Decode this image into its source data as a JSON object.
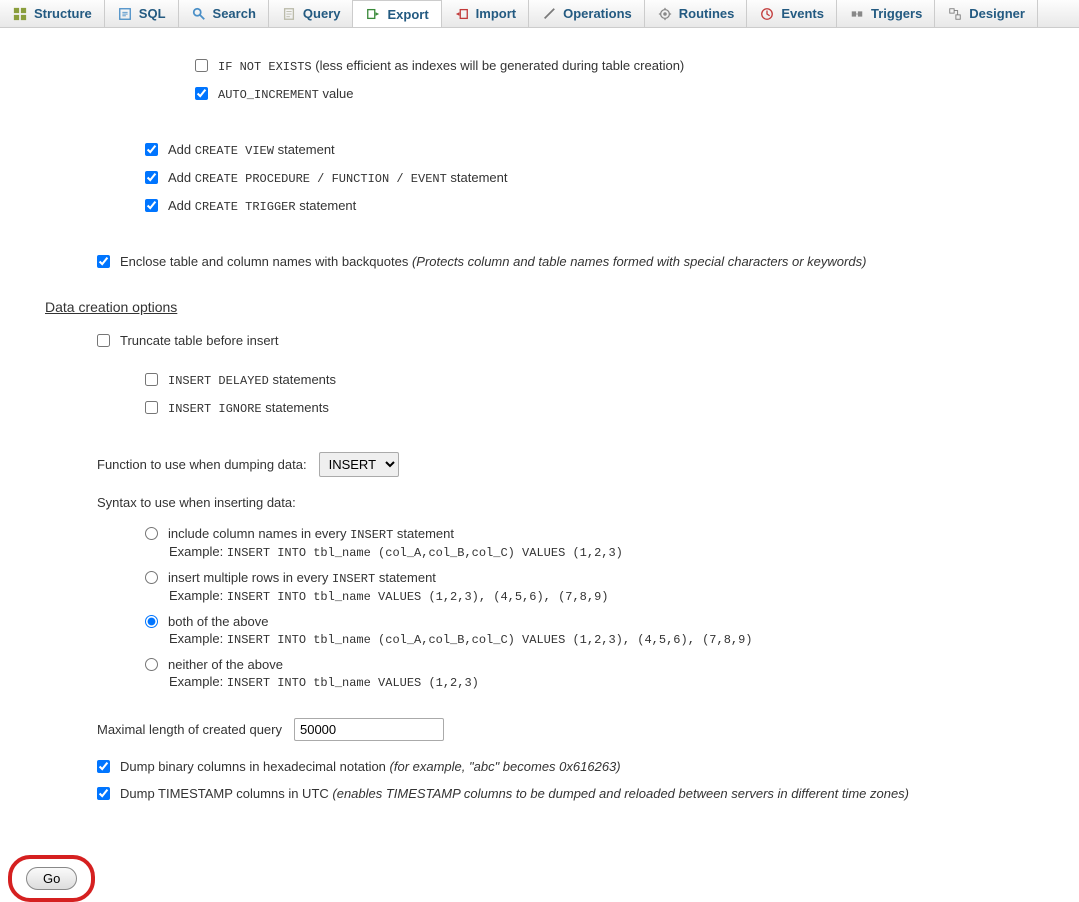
{
  "tabs": {
    "structure": "Structure",
    "sql": "SQL",
    "search": "Search",
    "query": "Query",
    "export": "Export",
    "import": "Import",
    "operations": "Operations",
    "routines": "Routines",
    "events": "Events",
    "triggers": "Triggers",
    "designer": "Designer"
  },
  "opts": {
    "if_not_exists_code": "IF NOT EXISTS",
    "if_not_exists_note": " (less efficient as indexes will be generated during table creation)",
    "auto_inc_code": "AUTO_INCREMENT",
    "auto_inc_tail": " value",
    "add_pre": "Add ",
    "create_view_code": "CREATE VIEW",
    "stmt_tail": " statement",
    "create_proc_code": "CREATE PROCEDURE / FUNCTION / EVENT",
    "create_trigger_code": "CREATE TRIGGER",
    "backquotes_label": "Enclose table and column names with backquotes ",
    "backquotes_note": "(Protects column and table names formed with special characters or keywords)"
  },
  "data_section": {
    "title": "Data creation options",
    "truncate": "Truncate table before insert",
    "insert_delayed_code": "INSERT DELAYED",
    "stmts_tail": " statements",
    "insert_ignore_code": "INSERT IGNORE",
    "func_label": "Function to use when dumping data:",
    "func_value": "INSERT",
    "syntax_label": "Syntax to use when inserting data:",
    "r1_pre": "include column names in every ",
    "r1_code": "INSERT",
    "r1_post": " statement",
    "example_label": "Example: ",
    "r1_example": "INSERT INTO tbl_name (col_A,col_B,col_C) VALUES (1,2,3)",
    "r2_pre": "insert multiple rows in every ",
    "r2_code": "INSERT",
    "r2_post": " statement",
    "r2_example": "INSERT INTO tbl_name VALUES (1,2,3), (4,5,6), (7,8,9)",
    "r3_label": "both of the above",
    "r3_example": "INSERT INTO tbl_name (col_A,col_B,col_C) VALUES (1,2,3), (4,5,6), (7,8,9)",
    "r4_label": "neither of the above",
    "r4_example": "INSERT INTO tbl_name VALUES (1,2,3)",
    "maxlen_label": "Maximal length of created query",
    "maxlen_value": "50000",
    "hex_label": "Dump binary columns in hexadecimal notation ",
    "hex_note": "(for example, \"abc\" becomes 0x616263)",
    "utc_label": "Dump TIMESTAMP columns in UTC ",
    "utc_note": "(enables TIMESTAMP columns to be dumped and reloaded between servers in different time zones)"
  },
  "go": "Go"
}
